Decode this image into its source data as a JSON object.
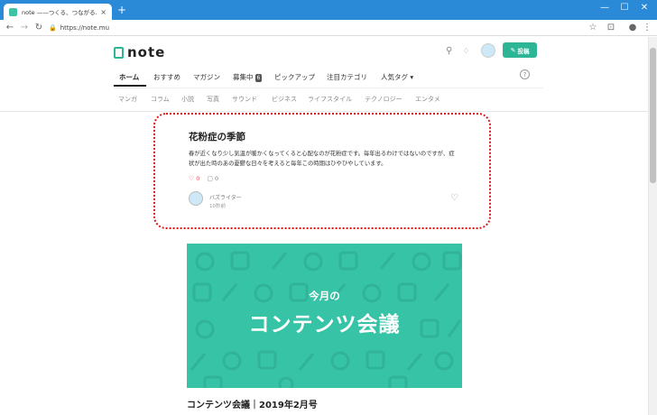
{
  "browser": {
    "tab_title": "note ——つくる、つながる、とどける。",
    "tab_close": "×",
    "new_tab": "+",
    "minimize": "—",
    "maximize": "☐",
    "close": "✕",
    "back": "←",
    "forward": "→",
    "reload": "↻",
    "url": "https://note.mu",
    "bookmark_star": "☆",
    "profile": "●",
    "menu": "⋮",
    "extension": "⊡"
  },
  "header": {
    "logo_text": "note",
    "search_icon": "⚲",
    "bell_icon": "🔔",
    "post_label": "投稿",
    "post_icon": "✎"
  },
  "nav": {
    "items": [
      {
        "label": "ホーム"
      },
      {
        "label": "おすすめ"
      },
      {
        "label": "マガジン"
      },
      {
        "label": "募集中",
        "badge": "6"
      },
      {
        "label": "ピックアップ"
      },
      {
        "label": "注目カテゴリ"
      },
      {
        "label": "人気タグ ▾"
      }
    ],
    "help": "?"
  },
  "categories": [
    "マンガ",
    "コラム",
    "小説",
    "写真",
    "サウンド",
    "ビジネス",
    "ライフスタイル",
    "テクノロジー",
    "エンタメ"
  ],
  "card": {
    "title": "花粉症の季節",
    "body": "春が近くなり少し気温が暖かくなってくると心配なのが花粉症です。毎年出るわけではないのですが、症状が出た時のあの憂鬱な日々を考えると毎年この時期はひやひやしています。",
    "like_icon": "♡",
    "likes": "0",
    "comment_icon": "▢",
    "comments": "0",
    "author": "バズライター",
    "time": "10秒前",
    "heart": "♡"
  },
  "banner": {
    "subtitle": "今月の",
    "title": "コンテンツ会議"
  },
  "article": {
    "title": "コンテンツ会議｜2019年2月号"
  },
  "colors": {
    "brand": "#2cb696",
    "banner": "#36c3a6",
    "highlight": "#d61a1a",
    "chrome": "#2a8ad8"
  }
}
